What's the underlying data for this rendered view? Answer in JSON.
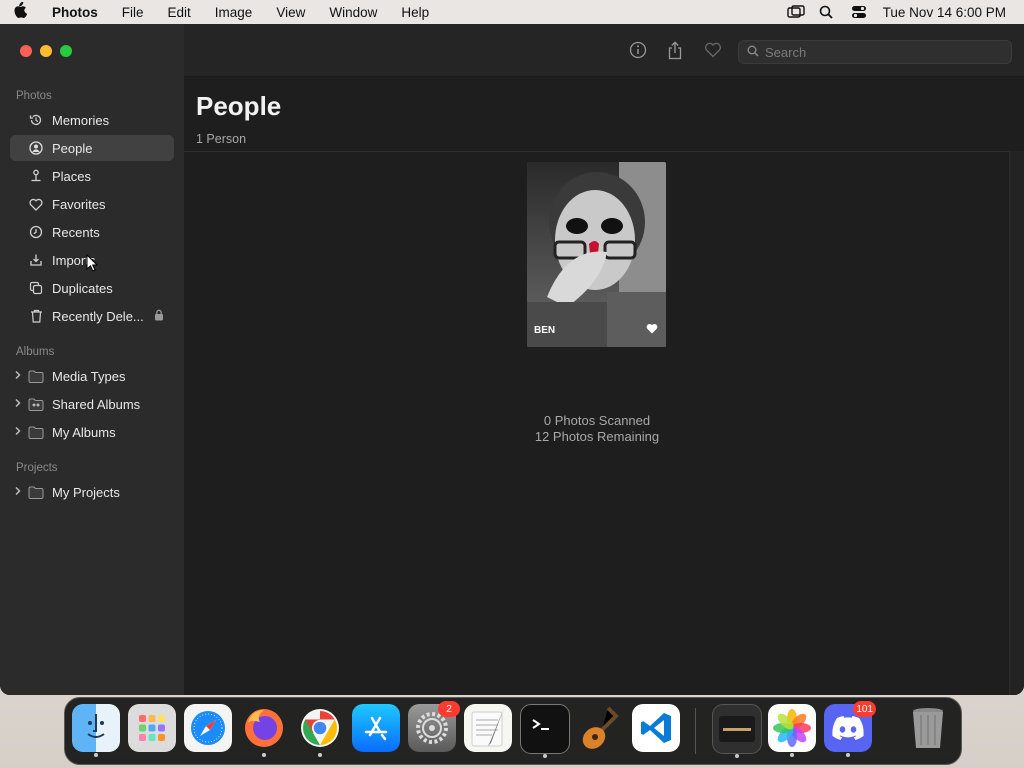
{
  "menubar": {
    "app_name": "Photos",
    "items": [
      "File",
      "Edit",
      "Image",
      "View",
      "Window",
      "Help"
    ],
    "clock": "Tue Nov 14  6:00 PM"
  },
  "sidebar": {
    "section_photos": "Photos",
    "items": [
      {
        "label": "Memories",
        "icon": "memories-icon"
      },
      {
        "label": "People",
        "icon": "people-icon"
      },
      {
        "label": "Places",
        "icon": "places-icon"
      },
      {
        "label": "Favorites",
        "icon": "heart-icon"
      },
      {
        "label": "Recents",
        "icon": "clock-icon"
      },
      {
        "label": "Imports",
        "icon": "import-icon"
      },
      {
        "label": "Duplicates",
        "icon": "duplicates-icon"
      },
      {
        "label": "Recently Dele...",
        "icon": "trash-icon"
      }
    ],
    "selected": "People",
    "section_albums": "Albums",
    "albums": [
      {
        "label": "Media Types"
      },
      {
        "label": "Shared Albums"
      },
      {
        "label": "My Albums"
      }
    ],
    "section_projects": "Projects",
    "projects": [
      {
        "label": "My Projects"
      }
    ]
  },
  "toolbar": {
    "search_placeholder": "Search"
  },
  "main": {
    "title": "People",
    "subtitle": "1 Person",
    "person_name": "BEN",
    "scan_line1": "0 Photos Scanned",
    "scan_line2": "12 Photos Remaining"
  },
  "dock": {
    "apps": [
      "Finder",
      "Launchpad",
      "Safari",
      "Firefox",
      "Chrome",
      "App Store",
      "System Settings",
      "TextEdit",
      "Terminal",
      "GarageBand",
      "Visual Studio Code",
      "Notes",
      "Photos",
      "Discord",
      "Trash"
    ],
    "settings_badge": "2",
    "discord_badge": "101"
  },
  "colors": {
    "accent_close": "#ff5f57",
    "accent_min": "#febc2e",
    "accent_max": "#28c840",
    "badge": "#ff3b30"
  }
}
